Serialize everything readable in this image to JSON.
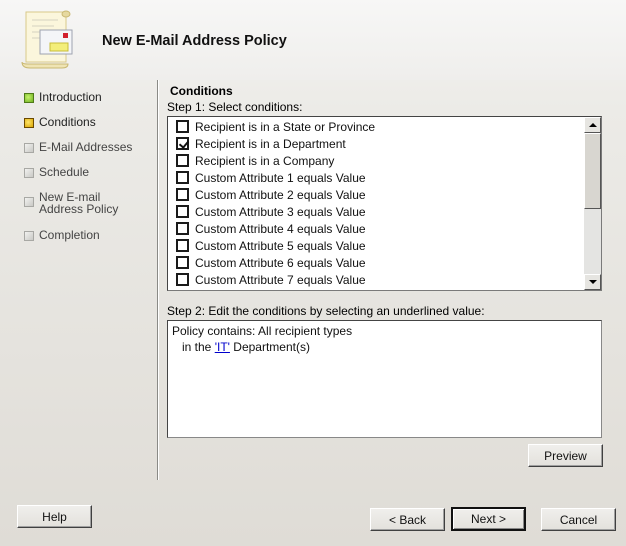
{
  "window": {
    "title": "New E-Mail Address Policy",
    "header_icon": "scroll-envelope-icon"
  },
  "sidebar": {
    "steps": [
      {
        "label": "Introduction",
        "state": "done"
      },
      {
        "label": "Conditions",
        "state": "current"
      },
      {
        "label": "E-Mail Addresses",
        "state": "pending"
      },
      {
        "label": "Schedule",
        "state": "pending"
      },
      {
        "label": "New E-mail Address Policy",
        "state": "pending"
      },
      {
        "label": "Completion",
        "state": "pending"
      }
    ]
  },
  "main": {
    "section_title": "Conditions",
    "step1_label": "Step 1: Select conditions:",
    "conditions": [
      {
        "label": "Recipient is in a State or Province",
        "checked": false
      },
      {
        "label": "Recipient is in a Department",
        "checked": true
      },
      {
        "label": "Recipient is in a Company",
        "checked": false
      },
      {
        "label": "Custom Attribute 1 equals Value",
        "checked": false
      },
      {
        "label": "Custom Attribute 2 equals Value",
        "checked": false
      },
      {
        "label": "Custom Attribute 3 equals Value",
        "checked": false
      },
      {
        "label": "Custom Attribute 4 equals Value",
        "checked": false
      },
      {
        "label": "Custom Attribute 5 equals Value",
        "checked": false
      },
      {
        "label": "Custom Attribute 6 equals Value",
        "checked": false
      },
      {
        "label": "Custom Attribute 7 equals Value",
        "checked": false
      }
    ],
    "step2_label": "Step 2: Edit the conditions by selecting an underlined value:",
    "policy": {
      "line1": "Policy contains: All recipient types",
      "line2_prefix": "in the ",
      "line2_value": "'IT'",
      "line2_suffix": " Department(s)"
    },
    "preview_label": "Preview"
  },
  "footer": {
    "help_label": "Help",
    "back_label": "< Back",
    "next_label": "Next >",
    "cancel_label": "Cancel"
  }
}
